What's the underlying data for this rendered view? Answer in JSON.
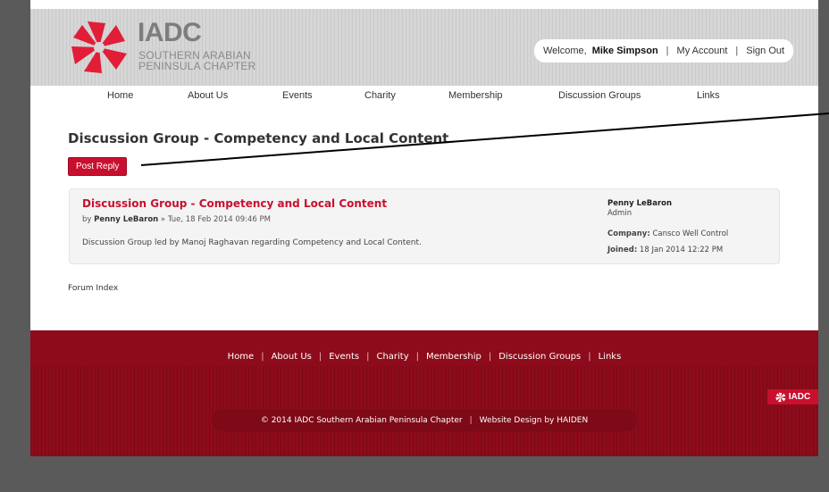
{
  "brand": {
    "title": "IADC",
    "subtitle_line1": "SOUTHERN ARABIAN",
    "subtitle_line2": "PENINSULA CHAPTER",
    "accent": "#c8102e",
    "footer_color": "#8d0b1b"
  },
  "user_bar": {
    "welcome": "Welcome,",
    "username": "Mike Simpson",
    "sep": "|",
    "my_account": "My Account",
    "sign_out": "Sign Out"
  },
  "nav": {
    "items": [
      {
        "label": "Home"
      },
      {
        "label": "About Us"
      },
      {
        "label": "Events"
      },
      {
        "label": "Charity"
      },
      {
        "label": "Membership"
      },
      {
        "label": "Discussion Groups"
      },
      {
        "label": "Links"
      }
    ]
  },
  "main": {
    "page_title": "Discussion Group - Competency and Local Content",
    "post_reply_label": "Post Reply",
    "post": {
      "title": "Discussion Group - Competency and Local Content",
      "by": "by",
      "author": "Penny LeBaron",
      "date": "» Tue, 18 Feb 2014 09:46 PM",
      "body": "Discussion Group led by Manoj Raghavan regarding Competency and Local Content."
    },
    "author_info": {
      "name": "Penny LeBaron",
      "role": "Admin",
      "company_label": "Company:",
      "company": "Cansco Well Control",
      "joined_label": "Joined:",
      "joined": "18 Jan 2014 12:22 PM"
    },
    "forum_index": "Forum Index"
  },
  "footer": {
    "nav": [
      {
        "label": "Home"
      },
      {
        "label": "About Us"
      },
      {
        "label": "Events"
      },
      {
        "label": "Charity"
      },
      {
        "label": "Membership"
      },
      {
        "label": "Discussion Groups"
      },
      {
        "label": "Links"
      }
    ],
    "sep": "|",
    "copyright": "© 2014 IADC Southern Arabian Peninsula Chapter",
    "design": "Website Design by HAIDEN",
    "badge": "IADC"
  }
}
